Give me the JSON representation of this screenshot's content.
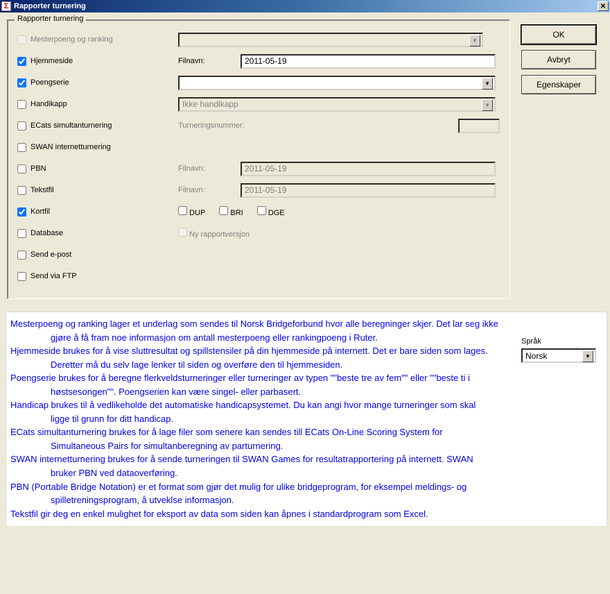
{
  "window": {
    "title": "Rapporter turnering",
    "icon_letter": "Σ"
  },
  "buttons": {
    "ok": "OK",
    "cancel": "Avbryt",
    "properties": "Egenskaper",
    "close_glyph": "✕"
  },
  "group": {
    "legend": "Rapporter turnering"
  },
  "rows": {
    "masterpoints": {
      "label": "Mesterpoeng og ranking"
    },
    "homepage": {
      "label": "Hjemmeside",
      "field_label": "Filnavn:",
      "value": "2011-05-19"
    },
    "series": {
      "label": "Poengserie"
    },
    "handicap": {
      "label": "Handikapp",
      "combo_value": "Ikke handikapp"
    },
    "ecats": {
      "label": "ECats simultanturnering",
      "field_label": "Turneringsnummer:"
    },
    "swan": {
      "label": "SWAN internetturnering"
    },
    "pbn": {
      "label": "PBN",
      "field_label": "Filnavn:",
      "value": "2011-05-19"
    },
    "text": {
      "label": "Tekstfil",
      "field_label": "Filnavn:",
      "value": "2011-05-19"
    },
    "card": {
      "label": "Kortfil",
      "dup": "DUP",
      "bri": "BRI",
      "dge": "DGE"
    },
    "database": {
      "label": "Database",
      "newreport": "Ny rapportversjon"
    },
    "email": {
      "label": "Send e-post"
    },
    "ftp": {
      "label": "Send via FTP"
    }
  },
  "language": {
    "label": "Språk",
    "value": "Norsk"
  },
  "help": {
    "p1a": "Mesterpoeng og ranking lager et underlag som sendes til Norsk Bridgeforbund hvor alle beregninger skjer. Det lar seg ikke",
    "p1b": "gjøre å få fram noe informasjon om antall mesterpoeng eller rankingpoeng i Ruter.",
    "p2a": "Hjemmeside brukes for å vise sluttresultat og spillstensiler på din hjemmeside på internett. Det er bare siden som lages.",
    "p2b": "Deretter må du selv lage lenker til siden og overføre den til hjemmesiden.",
    "p3a": "Poengserie brukes for å beregne flerkveldsturneringer eller turneringer av typen \"\"beste tre av fem\"\" eller \"\"beste ti i",
    "p3b": "høstsesongen\"\". Poengserien kan være singel- eller parbasert.",
    "p4a": "Handicap brukes til å vedlikeholde det automatiske handicapsystemet. Du kan angi hvor mange turneringer som skal",
    "p4b": "ligge til grunn for ditt handicap.",
    "p5a": "ECats simultanturnering brukes for å lage filer som senere kan sendes till ECats On-Line Scoring System for",
    "p5b": "Simultaneous Pairs for simultanberegning av parturnering.",
    "p6a": "SWAN internetturnering brukes for å sende turneringen til SWAN Games for resultatrapportering på internett. SWAN",
    "p6b": "bruker PBN ved dataoverføring.",
    "p7a": "PBN (Portable Bridge Notation) er et format som gjør det mulig for ulike bridgeprogram, for eksempel meldings- og",
    "p7b": "spilletreningsprogram, å utveklse informasjon.",
    "p8": "Tekstfil gir deg en enkel mulighet for eksport av data som siden kan åpnes i standardprogram som Excel."
  }
}
